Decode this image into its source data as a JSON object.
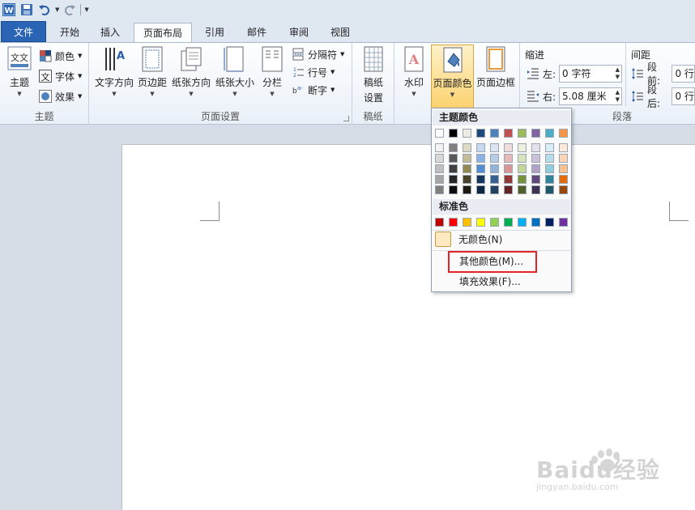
{
  "quick_access": {
    "icons": [
      "word-logo-icon",
      "save-icon",
      "undo-icon",
      "redo-icon",
      "customize-icon"
    ]
  },
  "tabs": [
    {
      "label": "文件"
    },
    {
      "label": "开始"
    },
    {
      "label": "插入"
    },
    {
      "label": "页面布局"
    },
    {
      "label": "引用"
    },
    {
      "label": "邮件"
    },
    {
      "label": "审阅"
    },
    {
      "label": "视图"
    }
  ],
  "active_tab": "页面布局",
  "ribbon": {
    "theme_group": {
      "label": "主题",
      "theme_button": "主题",
      "colors": "颜色",
      "fonts": "字体",
      "effects": "效果"
    },
    "page_setup_group": {
      "label": "页面设置",
      "text_direction": "文字方向",
      "margins": "页边距",
      "orientation": "纸张方向",
      "size": "纸张大小",
      "columns": "分栏",
      "breaks": "分隔符",
      "line_numbers": "行号",
      "hyphenation": "断字"
    },
    "draft_group": {
      "label": "稿纸",
      "draft_settings_line1": "稿纸",
      "draft_settings_line2": "设置"
    },
    "background_group": {
      "watermark": "水印",
      "page_color": "页面颜色",
      "page_borders": "页面边框"
    },
    "paragraph_group": {
      "label": "段落",
      "indent_title": "缩进",
      "indent_left_label": "左:",
      "indent_left_value": "0 字符",
      "indent_right_label": "右:",
      "indent_right_value": "5.08 厘米",
      "spacing_title": "间距",
      "spacing_before_label": "段前:",
      "spacing_before_value": "0 行",
      "spacing_after_label": "段后:",
      "spacing_after_value": "0 行"
    }
  },
  "page_color_menu": {
    "theme_colors_header": "主题颜色",
    "theme_top_row": [
      "#ffffff",
      "#000000",
      "#eeece1",
      "#1f497d",
      "#4f81bd",
      "#c0504d",
      "#9bbb59",
      "#8064a2",
      "#4bacc6",
      "#f79646"
    ],
    "theme_shades": [
      [
        "#f2f2f2",
        "#7f7f7f",
        "#ddd9c3",
        "#c6d9f0",
        "#dbe5f1",
        "#f2dcdb",
        "#ebf1dd",
        "#e5e0ec",
        "#dbeef3",
        "#fdeada"
      ],
      [
        "#d8d8d8",
        "#595959",
        "#c4bd97",
        "#8db3e2",
        "#b8cce4",
        "#e5b9b7",
        "#d7e3bc",
        "#ccc1d9",
        "#b7dde8",
        "#fbd5b5"
      ],
      [
        "#bfbfbf",
        "#3f3f3f",
        "#938953",
        "#548dd4",
        "#95b3d7",
        "#d99694",
        "#c3d69b",
        "#b2a2c7",
        "#92cddc",
        "#fac08f"
      ],
      [
        "#a5a5a5",
        "#262626",
        "#494429",
        "#17365d",
        "#366092",
        "#953734",
        "#76923c",
        "#5f497a",
        "#31859b",
        "#e36c09"
      ],
      [
        "#7f7f7f",
        "#0c0c0c",
        "#1d1b10",
        "#0f243e",
        "#244061",
        "#632423",
        "#4f6128",
        "#3f3151",
        "#205867",
        "#974806"
      ]
    ],
    "standard_colors_header": "标准色",
    "standard_colors": [
      "#c00000",
      "#ff0000",
      "#ffc000",
      "#ffff00",
      "#92d050",
      "#00b050",
      "#00b0f0",
      "#0070c0",
      "#002060",
      "#7030a0"
    ],
    "no_color": "无颜色(N)",
    "no_color_swatch": "#fdeac1",
    "more_colors": "其他颜色(M)...",
    "fill_effects": "填充效果(F)..."
  },
  "watermark_text": {
    "brand": "Baidu经验",
    "url": "jingyan.baidu.com"
  }
}
